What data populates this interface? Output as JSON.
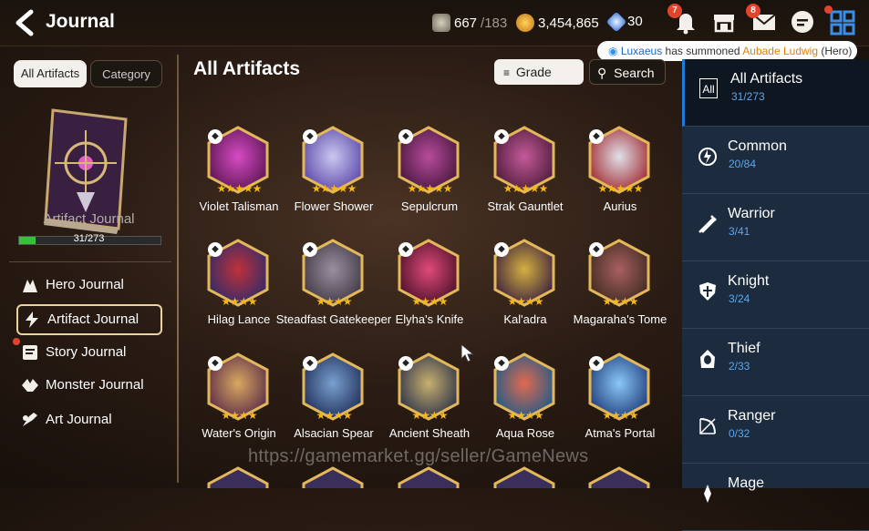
{
  "header": {
    "title": "Journal",
    "stamina": "667",
    "stamina_max": "/183",
    "gold": "3,454,865",
    "crystal": "30",
    "notif_bell": "7",
    "notif_mail": "8"
  },
  "toast": {
    "player": "Luxaeus",
    "text": " has summoned ",
    "hero": "Aubade Ludwig",
    "suffix": " (Hero)"
  },
  "left": {
    "tab_all": "All Artifacts",
    "tab_category": "Category",
    "book_label": "Artifact Journal",
    "progress_text": "31/273",
    "progress_fraction": 0.114,
    "menu": [
      {
        "label": "Hero Journal"
      },
      {
        "label": "Artifact Journal"
      },
      {
        "label": "Story Journal"
      },
      {
        "label": "Monster Journal"
      },
      {
        "label": "Art Journal"
      }
    ]
  },
  "main": {
    "title": "All Artifacts",
    "grade_label": "Grade",
    "search_label": "Search",
    "artifacts": [
      {
        "name": "Violet Talisman",
        "stars": "★★★★★",
        "colors": [
          "#d64bc4",
          "#5a1550"
        ]
      },
      {
        "name": "Flower Shower",
        "stars": "★★★★★",
        "colors": [
          "#c9c8f0",
          "#5b46a8"
        ]
      },
      {
        "name": "Sepulcrum",
        "stars": "★★★★★",
        "colors": [
          "#b84c9c",
          "#45163c"
        ]
      },
      {
        "name": "Strak Gauntlet",
        "stars": "★★★★★",
        "colors": [
          "#c45a9a",
          "#4b1a38"
        ]
      },
      {
        "name": "Aurius",
        "stars": "★★★★★",
        "colors": [
          "#e0e0e8",
          "#a02830"
        ]
      },
      {
        "name": "Hilag Lance",
        "stars": "★★★★",
        "colors": [
          "#c0303a",
          "#2c2c6a"
        ]
      },
      {
        "name": "Steadfast Gatekeeper",
        "stars": "★★★★",
        "colors": [
          "#9a8fa0",
          "#403844"
        ]
      },
      {
        "name": "Elyha's Knife",
        "stars": "★★★★",
        "colors": [
          "#e04a7a",
          "#4a1028"
        ]
      },
      {
        "name": "Kal'adra",
        "stars": "★★★★",
        "colors": [
          "#d4b040",
          "#3a1e3e"
        ]
      },
      {
        "name": "Magaraha's Tome",
        "stars": "★★★★",
        "colors": [
          "#a86060",
          "#3e2a20"
        ]
      },
      {
        "name": "Water's Origin",
        "stars": "★★★★",
        "colors": [
          "#d8a860",
          "#5a2a48"
        ]
      },
      {
        "name": "Alsacian Spear",
        "stars": "★★★★",
        "colors": [
          "#7aa0d0",
          "#1e2e58"
        ]
      },
      {
        "name": "Ancient Sheath",
        "stars": "★★★★",
        "colors": [
          "#c8b070",
          "#2a3048"
        ]
      },
      {
        "name": "Aqua Rose",
        "stars": "★★★★",
        "colors": [
          "#e06a50",
          "#1a5a8a"
        ]
      },
      {
        "name": "Atma's Portal",
        "stars": "★★★★",
        "colors": [
          "#8ac8f8",
          "#1e3a78"
        ]
      }
    ]
  },
  "sidebar": {
    "all_icon_text": "All",
    "items": [
      {
        "label": "All Artifacts",
        "count": "31/273"
      },
      {
        "label": "Common",
        "count": "20/84"
      },
      {
        "label": "Warrior",
        "count": "3/41"
      },
      {
        "label": "Knight",
        "count": "3/24"
      },
      {
        "label": "Thief",
        "count": "2/33"
      },
      {
        "label": "Ranger",
        "count": "0/32"
      },
      {
        "label": "Mage",
        "count": ""
      }
    ]
  },
  "watermark": "https://gamemarket.gg/seller/GameNews",
  "colors": {
    "accent_blue": "#1e7bd6",
    "gold_star": "#f5b619",
    "progress_green": "#35c13a"
  }
}
